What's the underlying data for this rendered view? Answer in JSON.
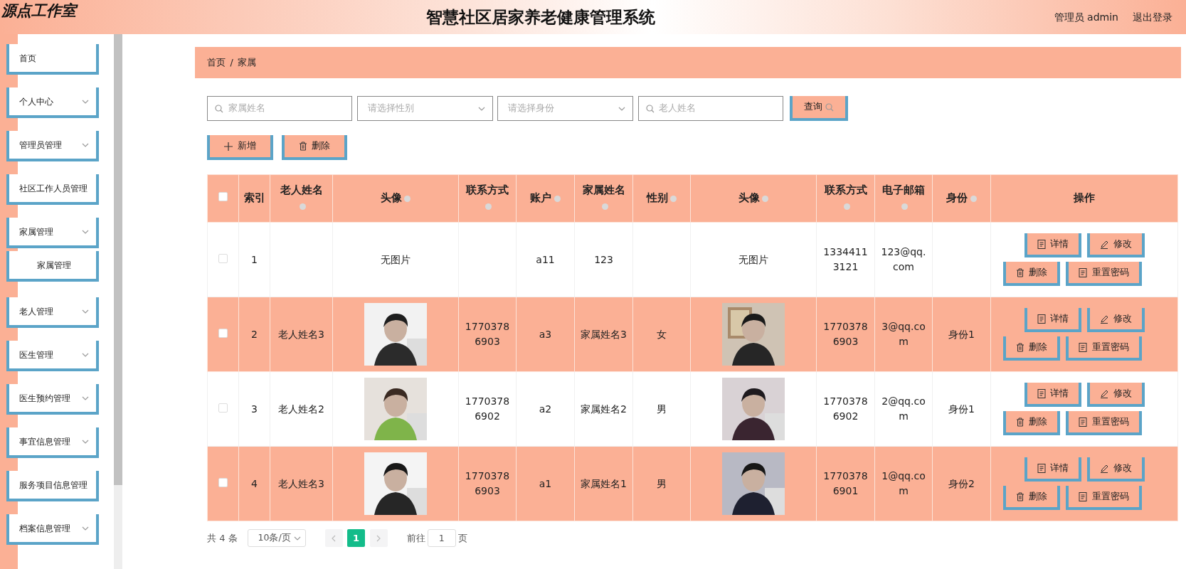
{
  "header": {
    "logo": "源点工作室",
    "title": "智慧社区居家养老健康管理系统",
    "user": "管理员 admin",
    "logout": "退出登录"
  },
  "sidebar": {
    "items": [
      {
        "label": "首页",
        "collapsible": false
      },
      {
        "label": "个人中心",
        "collapsible": true
      },
      {
        "label": "管理员管理",
        "collapsible": true
      },
      {
        "label": "社区工作人员管理",
        "collapsible": false
      },
      {
        "label": "家属管理",
        "collapsible": true,
        "children": [
          {
            "label": "家属管理"
          }
        ]
      },
      {
        "label": "老人管理",
        "collapsible": true
      },
      {
        "label": "医生管理",
        "collapsible": true
      },
      {
        "label": "医生预约管理",
        "collapsible": true
      },
      {
        "label": "事宜信息管理",
        "collapsible": true
      },
      {
        "label": "服务项目信息管理",
        "collapsible": false
      },
      {
        "label": "档案信息管理",
        "collapsible": true
      }
    ]
  },
  "breadcrumb": [
    "首页",
    "/",
    "家属"
  ],
  "filters": [
    {
      "kind": "search",
      "placeholder": "家属姓名"
    },
    {
      "kind": "select",
      "placeholder": "请选择性别"
    },
    {
      "kind": "select",
      "placeholder": "请选择身份"
    },
    {
      "kind": "search",
      "placeholder": "老人姓名"
    }
  ],
  "query_button": "查询",
  "toolbar": [
    {
      "kind": "add",
      "label": "新增"
    },
    {
      "kind": "delete",
      "label": "删除"
    }
  ],
  "table": {
    "all_selected": false,
    "columns": [
      {
        "label": "索引",
        "sortable": false,
        "kind": "text"
      },
      {
        "label": "老人姓名",
        "sortable": true,
        "kind": "text"
      },
      {
        "label": "头像",
        "sortable": true
      },
      {
        "label": "联系方式",
        "sortable": true,
        "kind": "text"
      },
      {
        "label": "账户",
        "sortable": true,
        "kind": "text"
      },
      {
        "label": "家属姓名",
        "sortable": true,
        "kind": "text"
      },
      {
        "label": "性别",
        "sortable": true,
        "kind": "text"
      },
      {
        "label": "头像",
        "sortable": true
      },
      {
        "label": "联系方式",
        "sortable": true,
        "kind": "text"
      },
      {
        "label": "电子邮箱",
        "sortable": true,
        "kind": "text"
      },
      {
        "label": "身份",
        "sortable": true,
        "kind": "text"
      },
      {
        "label": "操作",
        "sortable": false,
        "kind": "actions"
      }
    ],
    "rows": [
      {
        "selected": false,
        "cells": [
          "1",
          null,
          "无图片",
          null,
          "a11",
          "123",
          null,
          "无图片",
          "13344113121",
          "123@qq.com",
          null
        ],
        "actions": [
          {
            "kind": "detail",
            "label": "详情"
          },
          {
            "kind": "edit",
            "label": "修改"
          },
          {
            "kind": "delete",
            "label": "删除"
          },
          {
            "kind": "reset",
            "label": "重置密码"
          }
        ]
      },
      {
        "selected": false,
        "cells": [
          "2",
          "老人姓名3",
          {
            "kind": "picture"
          },
          "17703786903",
          "a3",
          "家属姓名3",
          "女",
          {
            "kind": "picture"
          },
          "17703786903",
          "3@qq.com",
          "身份1"
        ],
        "actions": [
          {
            "kind": "detail",
            "label": "详情"
          },
          {
            "kind": "edit",
            "label": "修改"
          },
          {
            "kind": "delete",
            "label": "删除"
          },
          {
            "kind": "reset",
            "label": "重置密码"
          }
        ]
      },
      {
        "selected": false,
        "cells": [
          "3",
          "老人姓名2",
          {
            "kind": "picture"
          },
          "17703786902",
          "a2",
          "家属姓名2",
          "男",
          {
            "kind": "picture"
          },
          "17703786902",
          "2@qq.com",
          "身份1"
        ],
        "actions": [
          {
            "kind": "detail",
            "label": "详情"
          },
          {
            "kind": "edit",
            "label": "修改"
          },
          {
            "kind": "delete",
            "label": "删除"
          },
          {
            "kind": "reset",
            "label": "重置密码"
          }
        ]
      },
      {
        "selected": false,
        "cells": [
          "4",
          "老人姓名3",
          {
            "kind": "picture"
          },
          "17703786903",
          "a1",
          "家属姓名1",
          "男",
          {
            "kind": "picture"
          },
          "17703786901",
          "1@qq.com",
          "身份2"
        ],
        "actions": [
          {
            "kind": "detail",
            "label": "详情"
          },
          {
            "kind": "edit",
            "label": "修改"
          },
          {
            "kind": "delete",
            "label": "删除"
          },
          {
            "kind": "reset",
            "label": "重置密码"
          }
        ]
      }
    ]
  },
  "pagination": {
    "total": "共 4 条",
    "page_size": "10条/页",
    "pages": [
      {
        "label": "1",
        "selected": true
      }
    ],
    "goto_label": "前往",
    "goto_value": "1",
    "goto_suffix": "页"
  }
}
